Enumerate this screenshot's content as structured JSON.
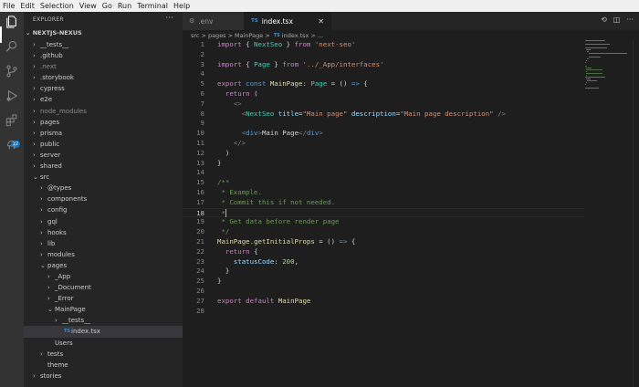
{
  "menu": [
    "File",
    "Edit",
    "Selection",
    "View",
    "Go",
    "Run",
    "Terminal",
    "Help"
  ],
  "activity": {
    "icons": [
      "files-icon",
      "search-icon",
      "source-control-icon",
      "run-debug-icon",
      "extensions-icon",
      "remote-icon"
    ],
    "badge": "12"
  },
  "explorer": {
    "title": "EXPLORER",
    "more": "···",
    "root": "NEXTJS-NEXUS",
    "items": [
      {
        "label": "__tests__",
        "depth": 0,
        "open": false,
        "dim": false
      },
      {
        "label": ".github",
        "depth": 0,
        "open": false,
        "dim": false
      },
      {
        "label": ".next",
        "depth": 0,
        "open": false,
        "dim": true
      },
      {
        "label": ".storybook",
        "depth": 0,
        "open": false,
        "dim": false
      },
      {
        "label": "cypress",
        "depth": 0,
        "open": false,
        "dim": false
      },
      {
        "label": "e2e",
        "depth": 0,
        "open": false,
        "dim": false
      },
      {
        "label": "node_modules",
        "depth": 0,
        "open": false,
        "dim": true
      },
      {
        "label": "pages",
        "depth": 0,
        "open": false,
        "dim": false
      },
      {
        "label": "prisma",
        "depth": 0,
        "open": false,
        "dim": false
      },
      {
        "label": "public",
        "depth": 0,
        "open": false,
        "dim": false
      },
      {
        "label": "server",
        "depth": 0,
        "open": false,
        "dim": false
      },
      {
        "label": "shared",
        "depth": 0,
        "open": false,
        "dim": false
      },
      {
        "label": "src",
        "depth": 0,
        "open": true,
        "dim": false
      },
      {
        "label": "@types",
        "depth": 1,
        "open": false,
        "dim": false
      },
      {
        "label": "components",
        "depth": 1,
        "open": false,
        "dim": false
      },
      {
        "label": "config",
        "depth": 1,
        "open": false,
        "dim": false
      },
      {
        "label": "gql",
        "depth": 1,
        "open": false,
        "dim": false
      },
      {
        "label": "hooks",
        "depth": 1,
        "open": false,
        "dim": false
      },
      {
        "label": "lib",
        "depth": 1,
        "open": false,
        "dim": false
      },
      {
        "label": "modules",
        "depth": 1,
        "open": false,
        "dim": false
      },
      {
        "label": "pages",
        "depth": 1,
        "open": true,
        "dim": false
      },
      {
        "label": "_App",
        "depth": 2,
        "open": false,
        "dim": false
      },
      {
        "label": "_Document",
        "depth": 2,
        "open": false,
        "dim": false
      },
      {
        "label": "_Error",
        "depth": 2,
        "open": false,
        "dim": false
      },
      {
        "label": "MainPage",
        "depth": 2,
        "open": true,
        "dim": false
      },
      {
        "label": "__tests__",
        "depth": 3,
        "open": false,
        "dim": false
      },
      {
        "label": "index.tsx",
        "depth": 3,
        "file": true,
        "selected": true,
        "dim": false
      },
      {
        "label": "Users",
        "depth": 2,
        "open": false,
        "dim": false,
        "nochev": true
      },
      {
        "label": "tests",
        "depth": 1,
        "open": false,
        "dim": false
      },
      {
        "label": "theme",
        "depth": 1,
        "open": false,
        "dim": false,
        "nochev": true
      },
      {
        "label": "stories",
        "depth": 0,
        "open": false,
        "dim": false
      }
    ]
  },
  "tabs": [
    {
      "label": ".env",
      "active": false
    },
    {
      "label": "index.tsx",
      "active": true,
      "type": "TS"
    }
  ],
  "breadcrumbs": [
    "src",
    ">",
    "pages",
    ">",
    "MainPage",
    ">",
    "TS",
    "index.tsx",
    ">",
    "..."
  ],
  "editor": {
    "lines": [
      "import { NextSeo } from 'next-seo'",
      "",
      "import { Page } from '../_App/interfaces'",
      "",
      "export const MainPage: Page = () => {",
      "  return (",
      "    <>",
      "      <NextSeo title=\"Main page\" description=\"Main page description\" />",
      "",
      "      <div>Main Page</div>",
      "    </>",
      "  )",
      "}",
      "",
      "/**",
      " * Example.",
      " * Commit this if not needed.",
      " *",
      " * Get data before render page",
      " */",
      "MainPage.getInitialProps = () => {",
      "  return {",
      "    statusCode: 200,",
      "  }",
      "}",
      "",
      "export default MainPage",
      ""
    ],
    "current_line": 18
  }
}
